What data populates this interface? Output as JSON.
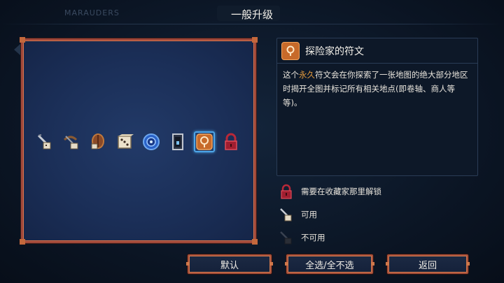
{
  "header": {
    "title": "一般升级",
    "faded_tab": "MARAUDERS"
  },
  "items": [
    {
      "name": "item-sword-dice",
      "icon": "sword-dice-icon"
    },
    {
      "name": "item-crossbow-dice",
      "icon": "crossbow-dice-icon"
    },
    {
      "name": "item-shield-dice",
      "icon": "shield-dice-icon"
    },
    {
      "name": "item-dice",
      "icon": "dice-icon"
    },
    {
      "name": "item-blue-orb",
      "icon": "blue-orb-icon"
    },
    {
      "name": "item-door",
      "icon": "door-icon"
    },
    {
      "name": "item-explorer-rune",
      "icon": "explorer-rune-icon",
      "selected": true
    },
    {
      "name": "item-locked",
      "icon": "lock-icon"
    }
  ],
  "info": {
    "title": "探险家的符文",
    "desc_prefix": "这个",
    "desc_highlight": "永久",
    "desc_suffix": "符文会在你探索了一张地图的绝大部分地区时揭开全图并标记所有相关地点(即卷轴、商人等等)。",
    "highlight_color": "#e49a3c"
  },
  "legend": {
    "locked": "需要在收藏家那里解锁",
    "available": "可用",
    "unavailable": "不可用"
  },
  "buttons": {
    "default": "默认",
    "select_all": "全选/全不选",
    "back": "返回"
  },
  "colors": {
    "accent_frame": "#a0483a",
    "panel_bg": "#1b2f58",
    "selection": "#4ea6e8"
  }
}
